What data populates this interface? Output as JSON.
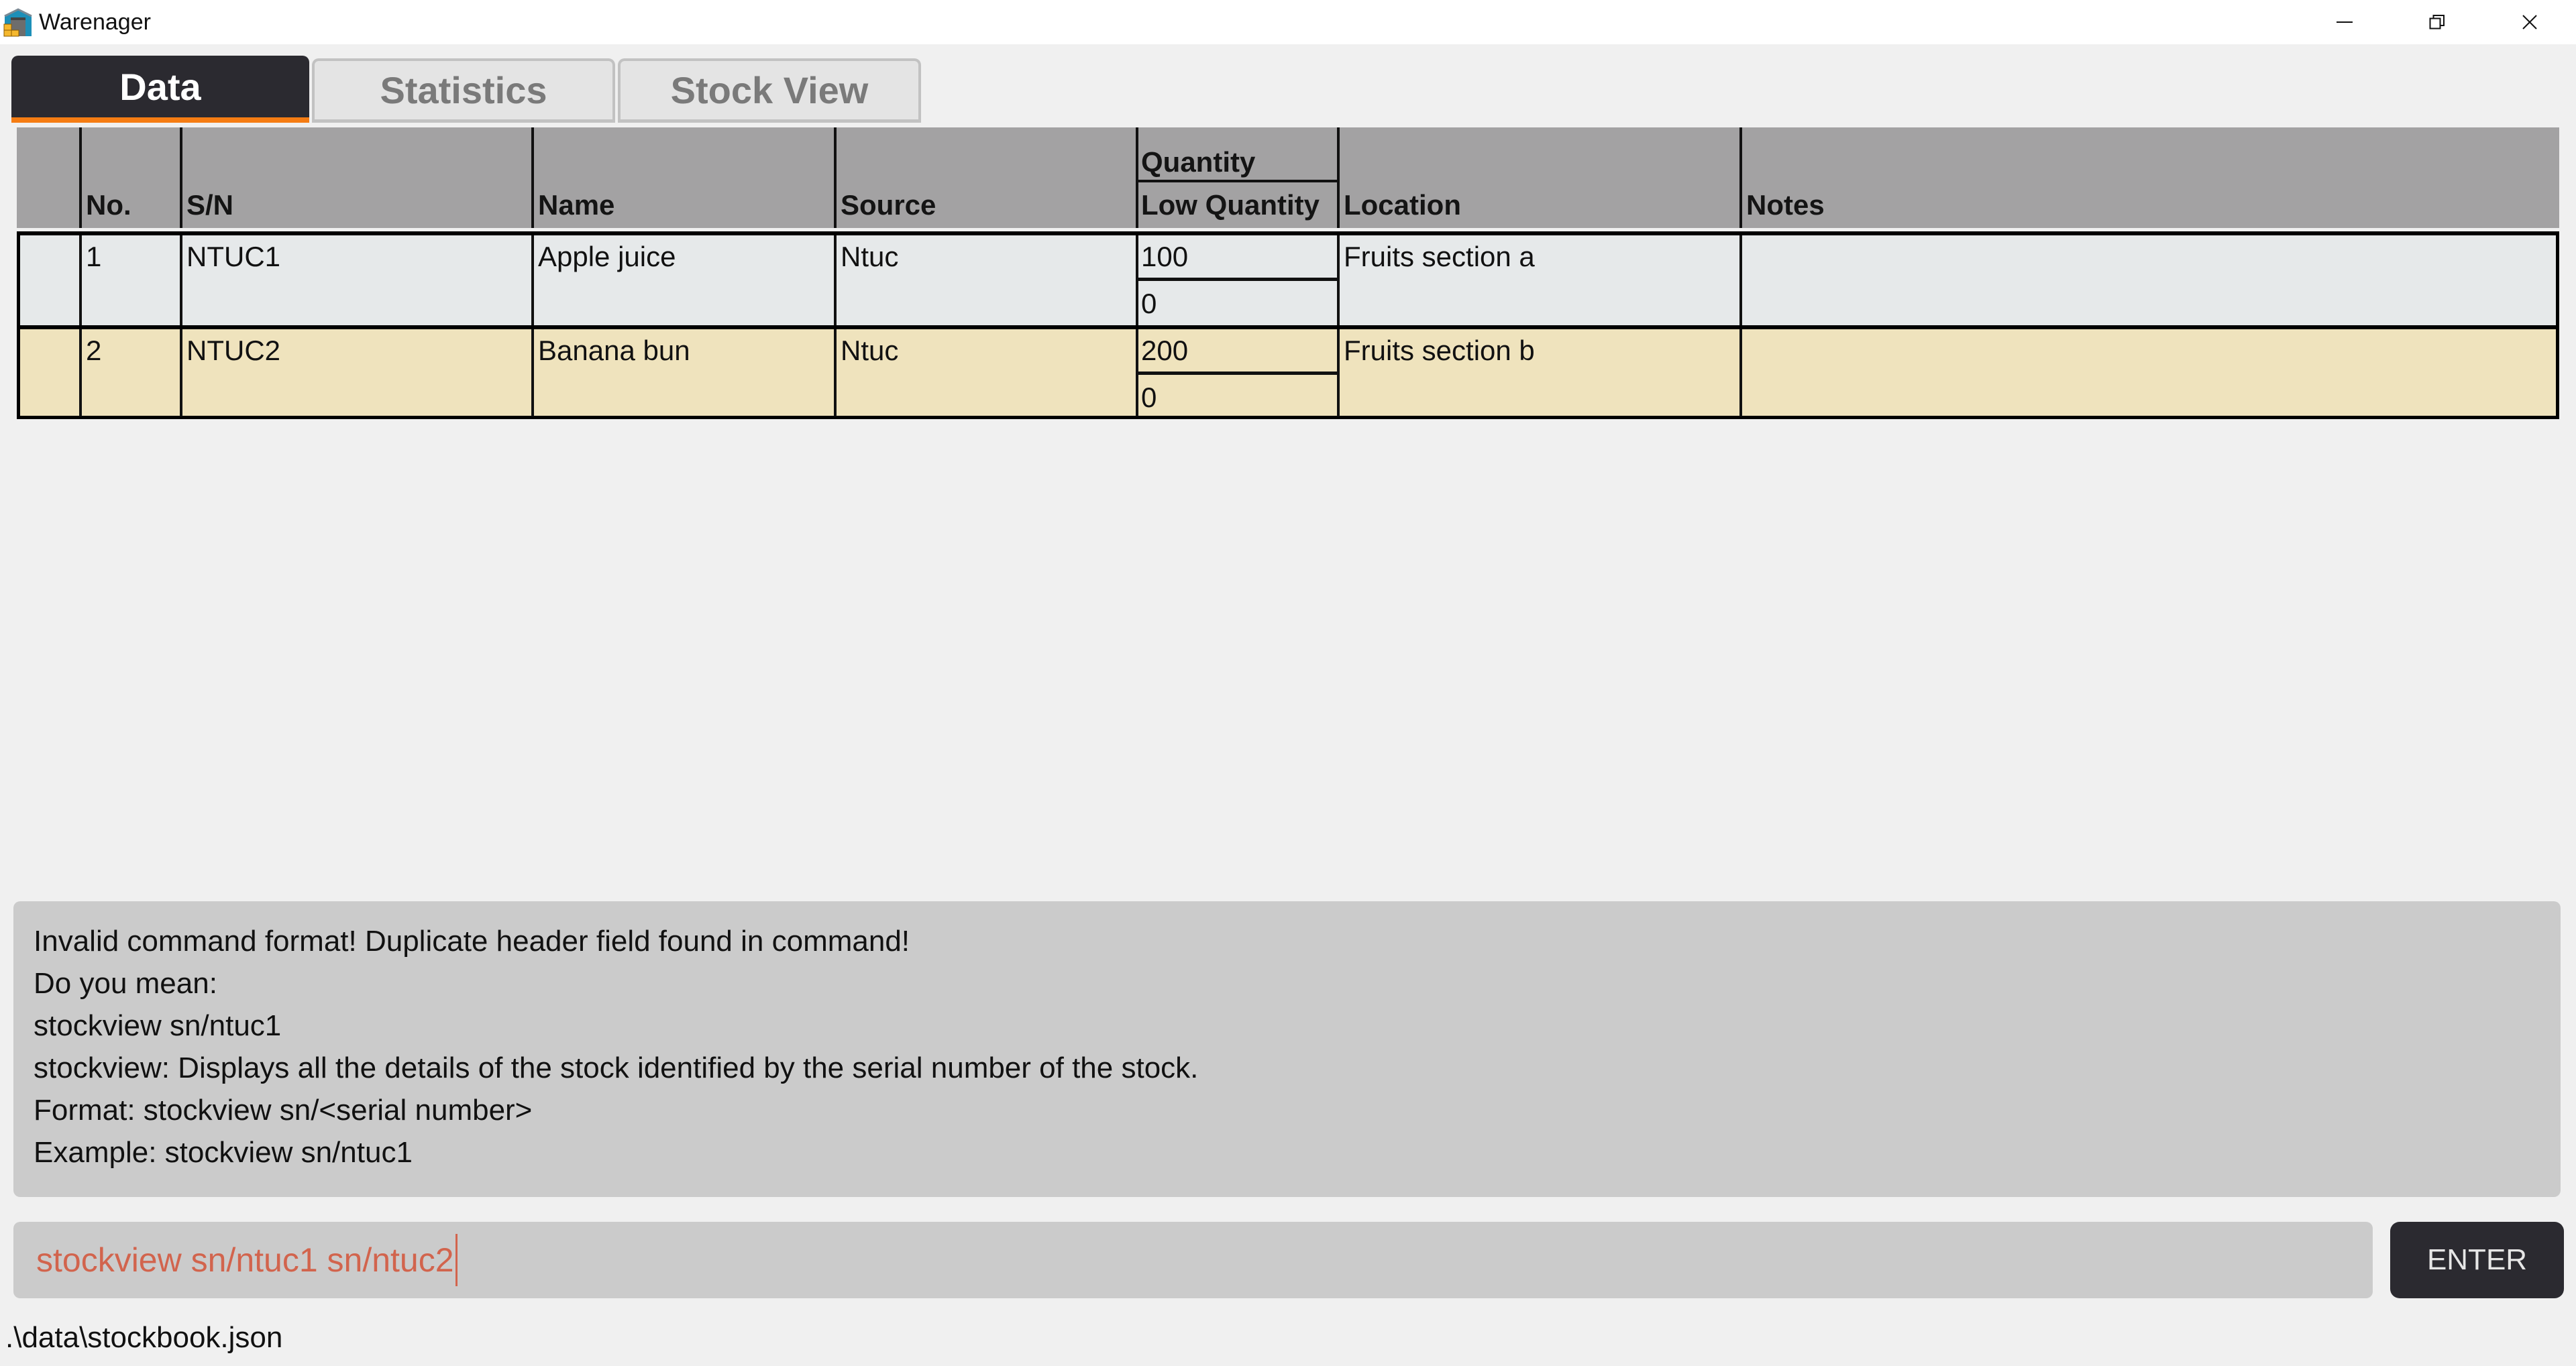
{
  "window": {
    "title": "Warenager",
    "app_icon": "warehouse-icon",
    "controls": [
      "minimize-icon",
      "restore-icon",
      "close-icon"
    ]
  },
  "tabs": [
    {
      "label": "Data",
      "active": true
    },
    {
      "label": "Statistics",
      "active": false
    },
    {
      "label": "Stock View",
      "active": false
    }
  ],
  "table": {
    "headers": {
      "index": "",
      "no": "No.",
      "sn": "S/N",
      "name": "Name",
      "source": "Source",
      "quantity": "Quantity",
      "low_quantity": "Low Quantity",
      "location": "Location",
      "notes": "Notes"
    },
    "rows": [
      {
        "no": "1",
        "sn": "NTUC1",
        "name": "Apple juice",
        "source": "Ntuc",
        "quantity": "100",
        "low_quantity": "0",
        "location": "Fruits section a",
        "notes": ""
      },
      {
        "no": "2",
        "sn": "NTUC2",
        "name": "Banana bun",
        "source": "Ntuc",
        "quantity": "200",
        "low_quantity": "0",
        "location": "Fruits section b",
        "notes": ""
      }
    ]
  },
  "result_display": {
    "lines": [
      "Invalid command format! Duplicate header field found in command!",
      "Do you mean:",
      "stockview sn/ntuc1",
      "stockview: Displays all the details of the stock identified by the serial number of the stock.",
      "Format: stockview sn/<serial number>",
      "Example: stockview sn/ntuc1"
    ]
  },
  "command_box": {
    "value": "stockview sn/ntuc1 sn/ntuc2",
    "enter_label": "ENTER",
    "error_color": "#d2644d"
  },
  "status_bar": {
    "file_path": ".\\data\\stockbook.json"
  },
  "colors": {
    "accent": "#f57c13",
    "tab_active_bg": "#2b2a30",
    "header_bg": "#a3a2a3",
    "row_odd_bg": "#e6e9ea",
    "row_even_bg": "#efe3bd"
  }
}
